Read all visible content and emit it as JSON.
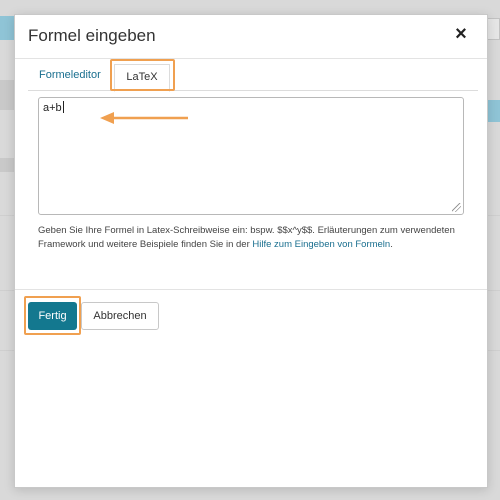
{
  "dialog": {
    "title": "Formel eingeben",
    "close_icon": "close-icon"
  },
  "tabs": [
    {
      "label": "Formeleditor",
      "active": false
    },
    {
      "label": "LaTeX",
      "active": true
    }
  ],
  "editor": {
    "value": "a+b"
  },
  "help": {
    "text": "Geben Sie Ihre Formel in Latex-Schreibweise ein: bspw. $$x^y$$. Erläuterungen zum verwendeten Framework und weitere Beispiele finden Sie in der ",
    "link": "Hilfe zum Eingeben von Formeln",
    "suffix": "."
  },
  "buttons": {
    "submit": "Fertig",
    "cancel": "Abbrechen"
  },
  "colors": {
    "accent": "#13788f",
    "link": "#1a6f8f",
    "highlight": "#f0a050"
  }
}
